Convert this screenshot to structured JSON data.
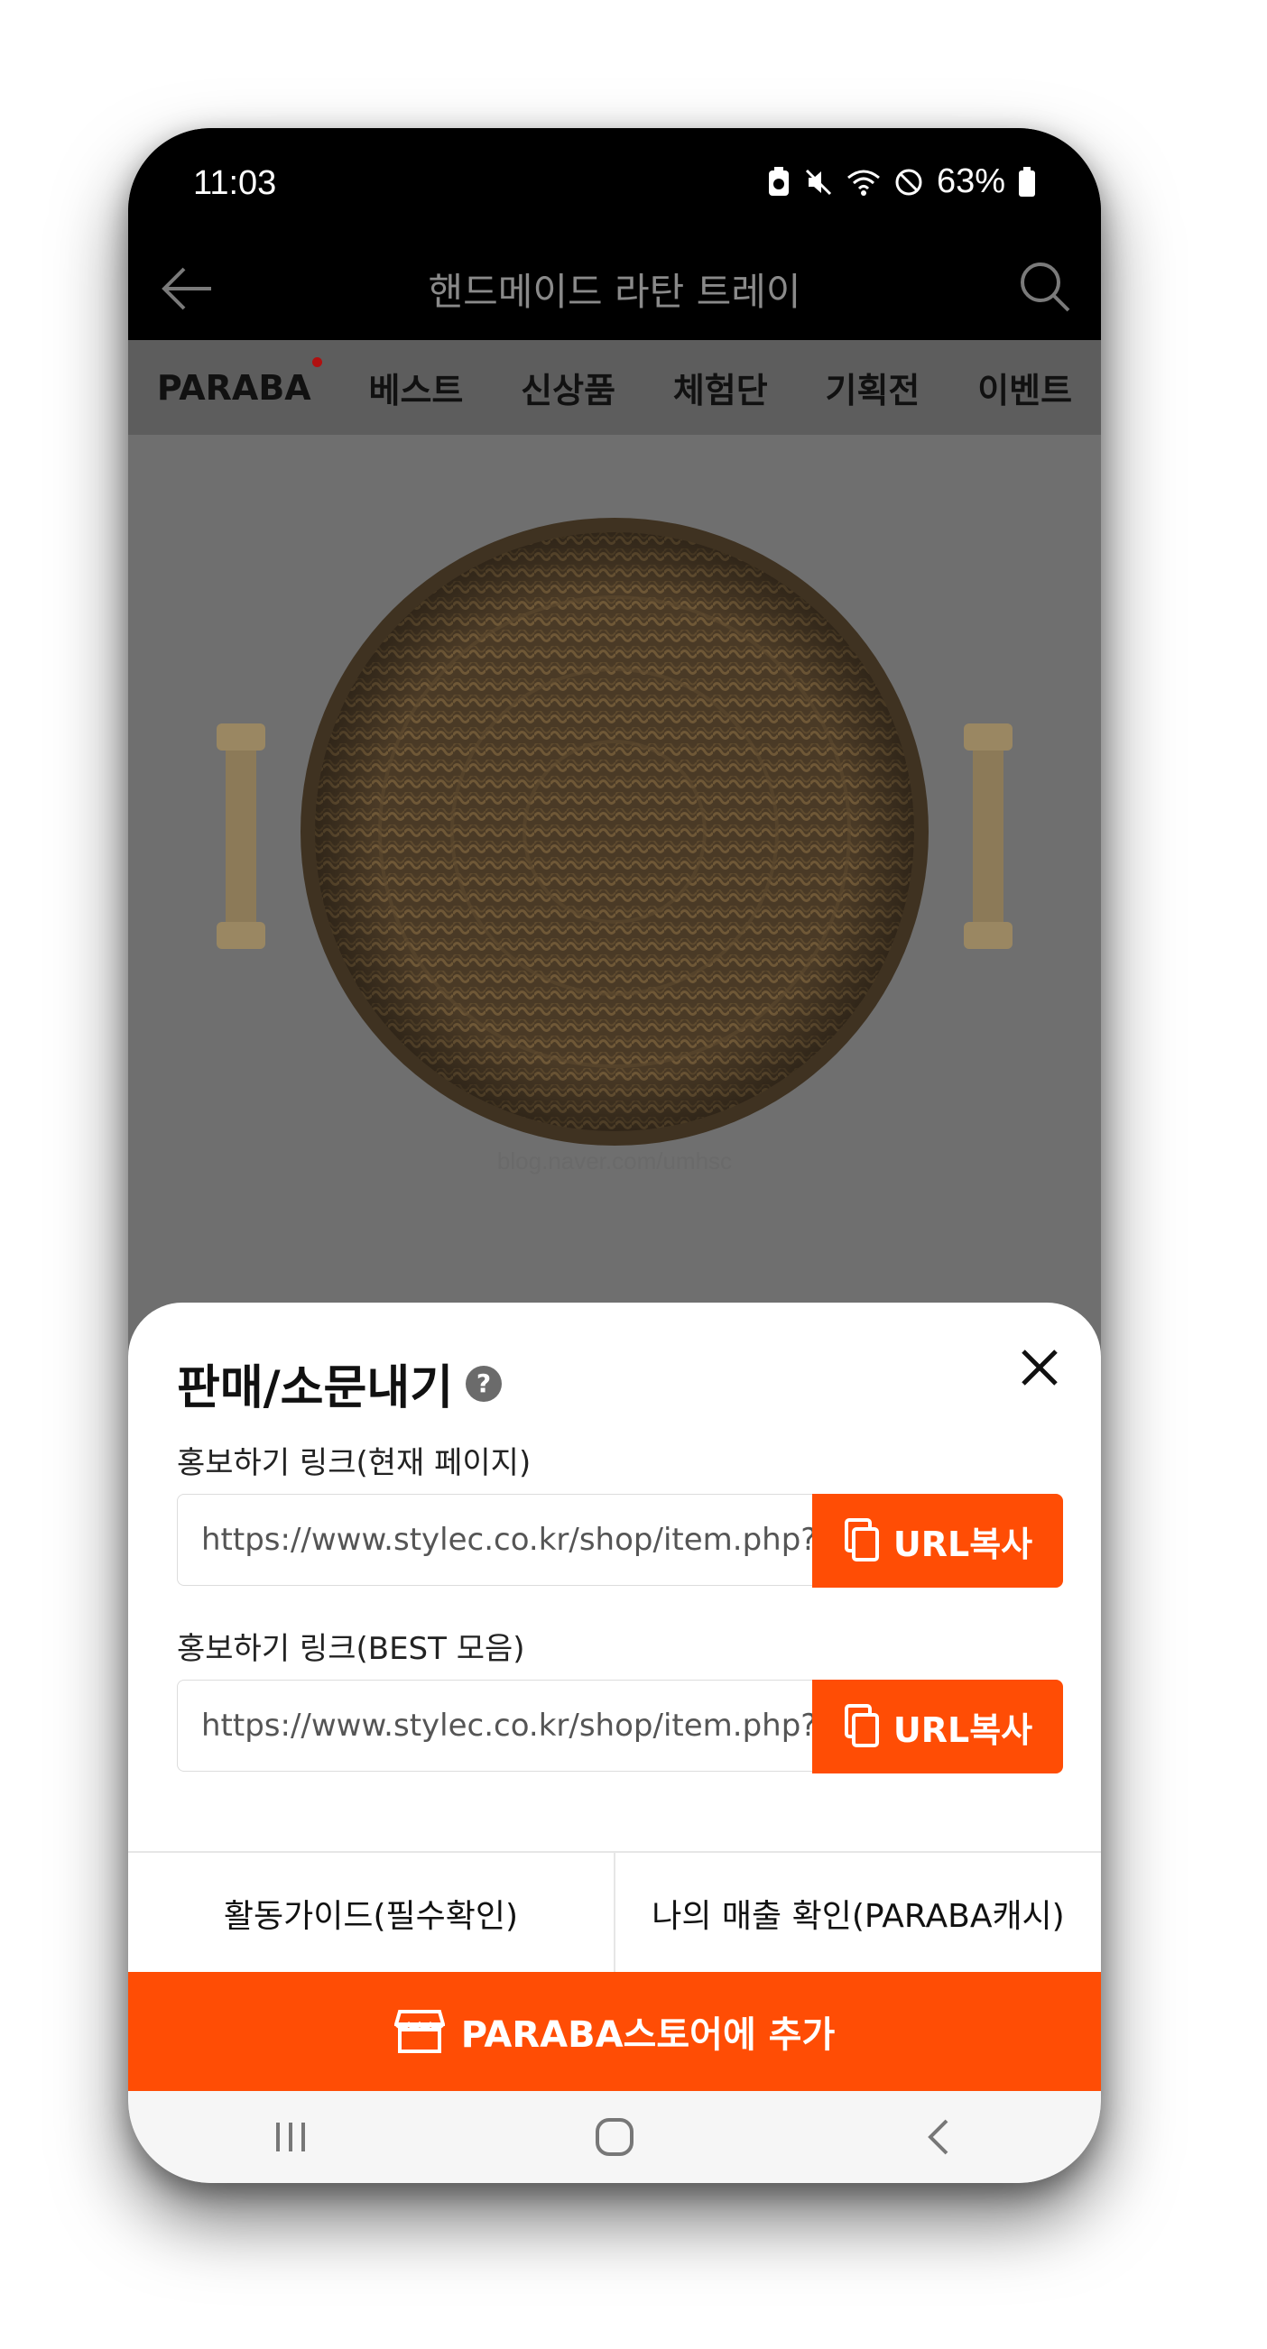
{
  "status_bar": {
    "time": "11:03",
    "battery": "63%"
  },
  "header": {
    "title": "핸드메이드 라탄 트레이"
  },
  "tabs": [
    {
      "label": "PARABA"
    },
    {
      "label": "베스트"
    },
    {
      "label": "신상품"
    },
    {
      "label": "체험단"
    },
    {
      "label": "기획전"
    },
    {
      "label": "이벤트"
    }
  ],
  "product_image": {
    "watermark": "blog.naver.com/umhsc"
  },
  "sheet": {
    "title": "판매/소문내기",
    "help_symbol": "?",
    "link1": {
      "label": "홍보하기 링크(현재 페이지)",
      "url": "https://www.stylec.co.kr/shop/item.php?it_id=",
      "button": "URL복사"
    },
    "link2": {
      "label": "홍보하기 링크(BEST 모음)",
      "url": "https://www.stylec.co.kr/shop/item.php?it_id=",
      "button": "URL복사"
    },
    "guide_button": "활동가이드(필수확인)",
    "sales_button": "나의 매출 확인(PARABA캐시)",
    "add_button": "PARABA스토어에 추가"
  },
  "colors": {
    "accent": "#ff4d05",
    "overlay": "#6f6f6f"
  }
}
